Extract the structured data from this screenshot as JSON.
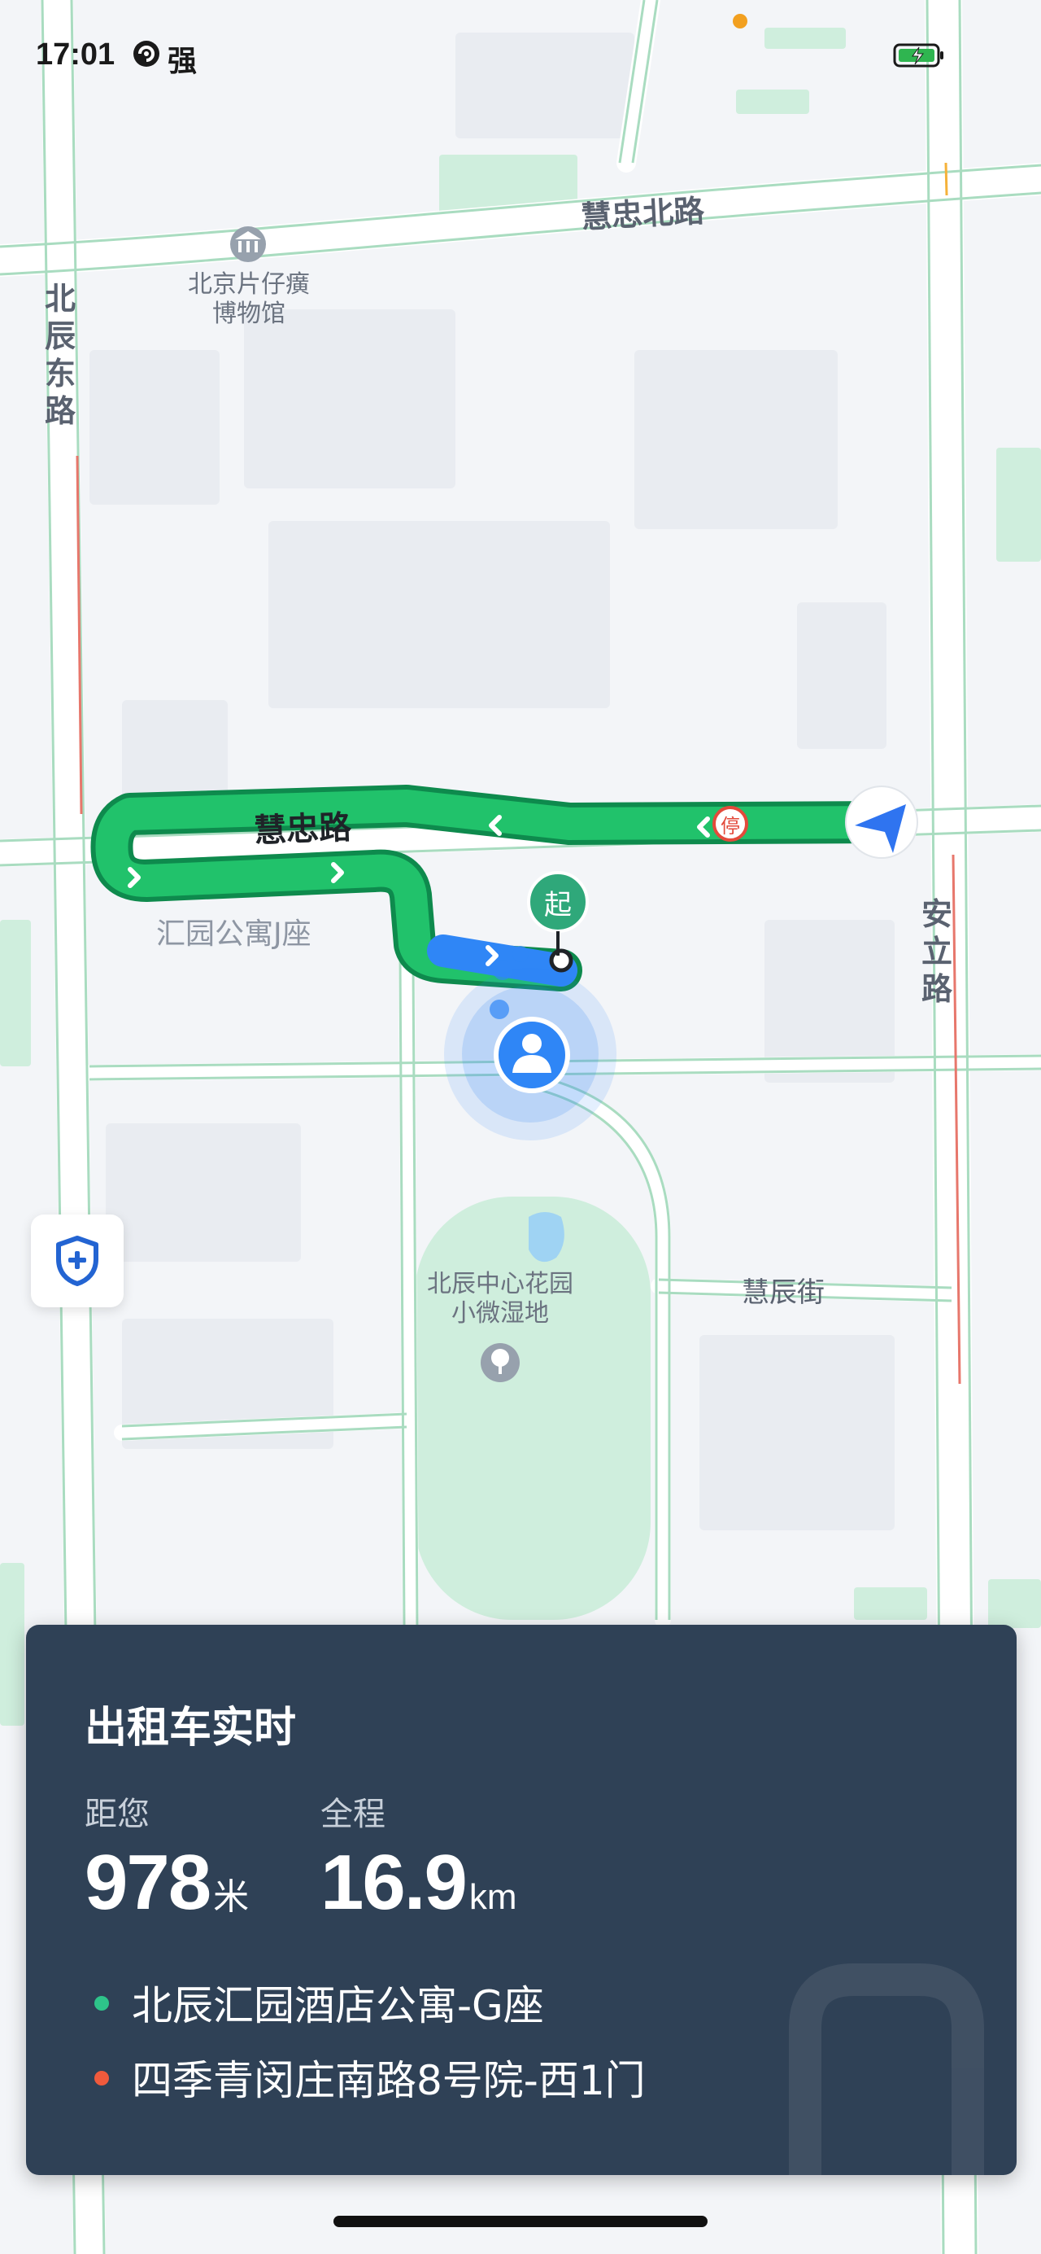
{
  "status_bar": {
    "time": "17:01",
    "network": "强",
    "network_icon": "signal-swirl-icon",
    "battery_icon": "battery-charging-icon",
    "battery_color": "#2fb550"
  },
  "map": {
    "roads": {
      "huizhong_north": "慧忠北路",
      "beichen_east": "北辰东路",
      "anli": "安立路",
      "huichen_street": "慧辰街",
      "huizhong": "慧忠路"
    },
    "pois": {
      "museum": "北京片仔癀博物馆",
      "apartment": "汇园公寓J座",
      "park": "北辰中心花园小微湿地"
    },
    "parking_sign": "停",
    "start_marker": "起",
    "route_color": "#21c26b",
    "route_traveled_color": "#2f86f6",
    "vehicle_arrow_color": "#2f74f0"
  },
  "safety_button": {
    "icon": "shield-plus-icon"
  },
  "trip_card": {
    "title": "出租车实时",
    "distance_label": "距您",
    "distance_value": "978",
    "distance_unit": "米",
    "total_label": "全程",
    "total_value": "16.9",
    "total_unit": "km",
    "pickup": "北辰汇园酒店公寓-G座",
    "pickup_color": "#2ec48a",
    "destination": "四季青闵庄南路8号院-西1门",
    "destination_color": "#f05a3c",
    "background_color": "#2f4156"
  }
}
